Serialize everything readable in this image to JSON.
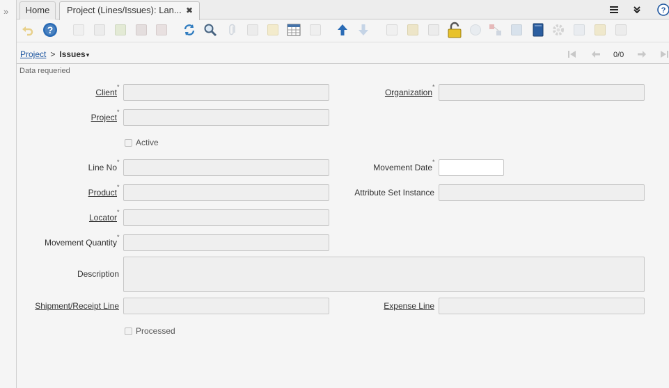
{
  "tabs": {
    "home": "Home",
    "active": "Project (Lines/Issues): Lan...",
    "close_glyph": "✖"
  },
  "tab_tools": {
    "menu_icon": "≡",
    "collapse_icon": "⌄",
    "help_icon": "?"
  },
  "left_rail": {
    "expand_glyph": "»"
  },
  "toolbar": {
    "icons": [
      "undo-icon",
      "help-icon",
      "new-icon",
      "copy-icon",
      "delete-icon",
      "save-icon",
      "save-new-icon",
      "refresh-icon",
      "find-icon",
      "attachment-icon",
      "chat-icon",
      "notes-icon",
      "grid-toggle-icon",
      "detail-icon",
      "parent-icon",
      "child-icon",
      "history-icon",
      "archive-icon",
      "print-icon",
      "lock-icon",
      "zoom-across-icon",
      "workflow-icon",
      "requests-icon",
      "product-info-icon",
      "process-icon",
      "report-icon",
      "export-icon",
      "import-icon"
    ]
  },
  "breadcrumb": {
    "parent": "Project",
    "separator": ">",
    "current": "Issues",
    "caret": "▾"
  },
  "navigation": {
    "first": "⏮",
    "previous": "◀",
    "record_count": "0/0",
    "next": "▶",
    "last": "⏭"
  },
  "status_message": "Data requeried",
  "form": {
    "client_label": "Client",
    "organization_label": "Organization",
    "project_label": "Project",
    "active_label": "Active",
    "line_no_label": "Line No",
    "movement_date_label": "Movement Date",
    "product_label": "Product",
    "attribute_set_instance_label": "Attribute Set Instance",
    "locator_label": "Locator",
    "movement_quantity_label": "Movement Quantity",
    "description_label": "Description",
    "shipment_receipt_line_label": "Shipment/Receipt Line",
    "expense_line_label": "Expense Line",
    "processed_label": "Processed",
    "required_mark": "*"
  },
  "colors": {
    "accent_blue": "#1e56a0",
    "lock_yellow": "#e8c22a"
  }
}
